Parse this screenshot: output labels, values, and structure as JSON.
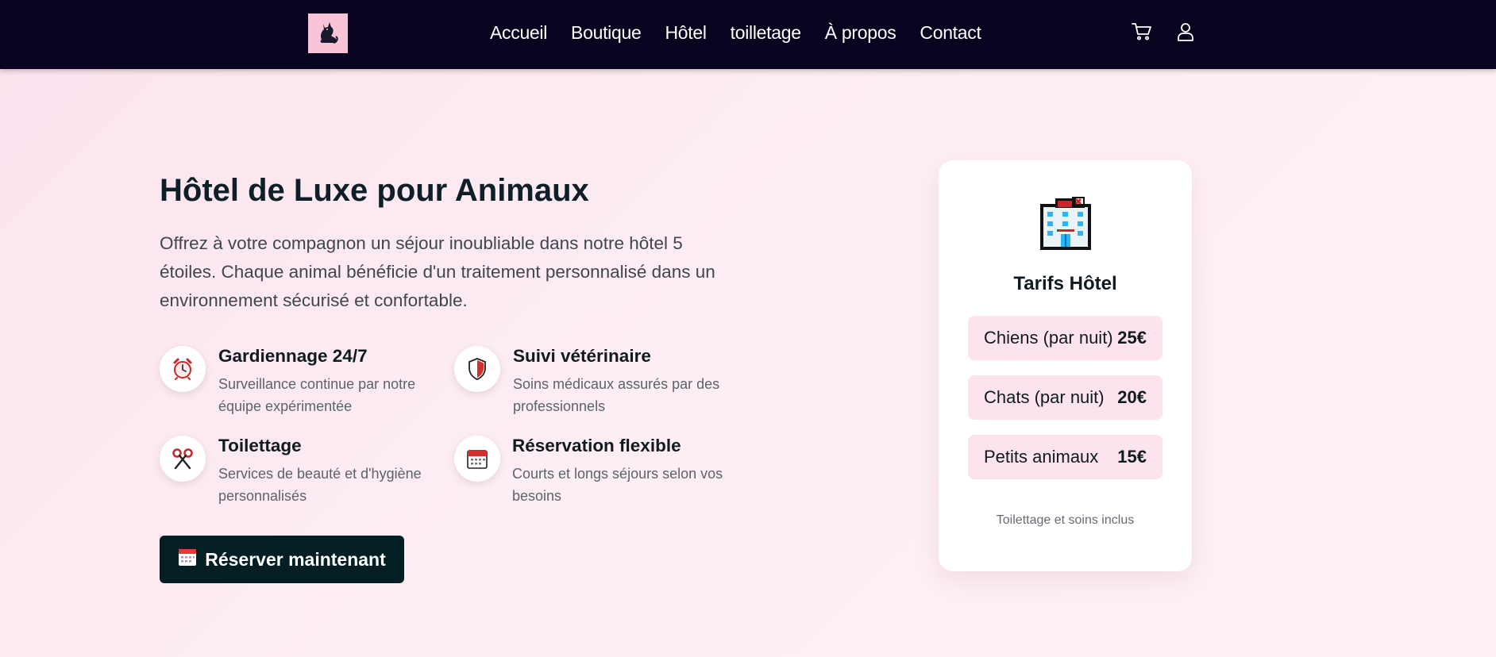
{
  "nav": {
    "logo_icon": "cat-icon",
    "links": [
      "Accueil",
      "Boutique",
      "Hôtel",
      "toilletage",
      "À propos",
      "Contact"
    ],
    "cart_icon": "cart-icon",
    "user_icon": "user-icon"
  },
  "hero": {
    "title": "Hôtel de Luxe pour Animaux",
    "description": "Offrez à votre compagnon un séjour inoubliable dans notre hôtel 5 étoiles. Chaque animal bénéficie d'un traitement personnalisé dans un environnement sécurisé et confortable.",
    "features": [
      {
        "icon": "alarm-clock-icon",
        "title": "Gardiennage 24/7",
        "text": "Surveillance continue par notre équipe expérimentée"
      },
      {
        "icon": "shield-icon",
        "title": "Suivi vétérinaire",
        "text": "Soins médicaux assurés par des professionnels"
      },
      {
        "icon": "scissors-icon",
        "title": "Toilettage",
        "text": "Services de beauté et d'hygiène personnalisés"
      },
      {
        "icon": "calendar-icon",
        "title": "Réservation flexible",
        "text": "Courts et longs séjours selon vos besoins"
      }
    ],
    "cta_label": "Réserver maintenant",
    "cta_icon": "calendar-icon"
  },
  "pricing": {
    "icon": "hotel-building-icon",
    "title": "Tarifs Hôtel",
    "rows": [
      {
        "label": "Chiens (par nuit)",
        "price": "25€"
      },
      {
        "label": "Chats (par nuit)",
        "price": "20€"
      },
      {
        "label": "Petits animaux",
        "price": "15€"
      }
    ],
    "note": "Toilettage et soins inclus"
  },
  "colors": {
    "navbar": "#080420",
    "logo_bg": "#f9c4d8",
    "cta_bg": "#031f24",
    "price_row_bg": "#fde3ed",
    "page_bg": "#fbe3ee"
  }
}
